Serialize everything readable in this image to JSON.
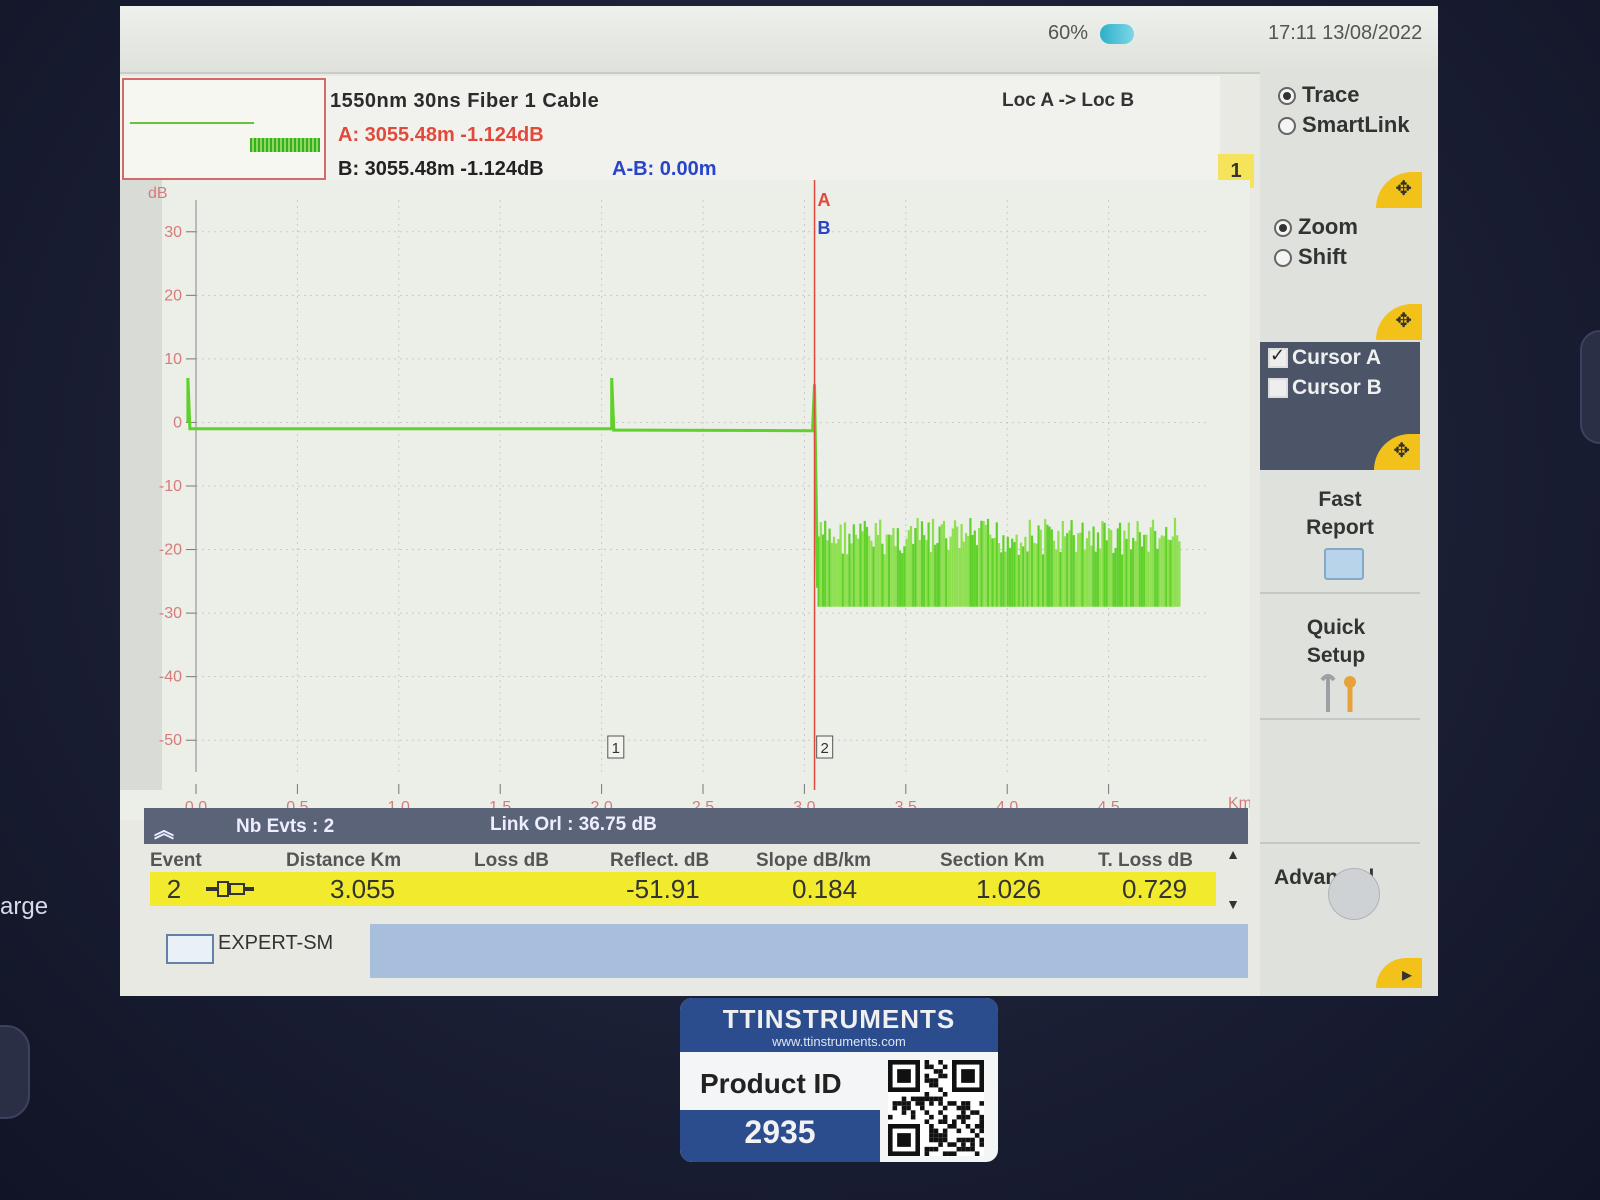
{
  "bezel": {
    "side_label": "arge"
  },
  "status": {
    "battery": "60%",
    "datetime": "17:11  13/08/2022"
  },
  "trace_info": {
    "line1": "1550nm  30ns  Fiber  1  Cable",
    "cursor_a": "A: 3055.48m -1.124dB",
    "cursor_b": "B: 3055.48m -1.124dB",
    "a_minus_b": "A-B: 0.00m",
    "direction": "Loc A -> Loc B",
    "trace_number": "1"
  },
  "right_panel": {
    "trace": "Trace",
    "smartlink": "SmartLink",
    "zoom": "Zoom",
    "shift": "Shift",
    "cursor_a": "Cursor A",
    "cursor_b": "Cursor B",
    "fast_report": [
      "Fast",
      "Report"
    ],
    "quick_setup": [
      "Quick",
      "Setup"
    ],
    "advanced": "Advanced",
    "accent_color": "#f2c21a"
  },
  "chart_data": {
    "type": "line",
    "ylabel": "dB",
    "xlabel": "Km",
    "xlim": [
      0.0,
      5.0
    ],
    "ylim": [
      -55,
      35
    ],
    "x_ticks": [
      "0.0",
      "0.5",
      "1.0",
      "1.5",
      "2.0",
      "2.5",
      "3.0",
      "3.5",
      "4.0",
      "4.5"
    ],
    "y_ticks": [
      "30",
      "20",
      "10",
      "0",
      "-10",
      "-20",
      "-30",
      "-40",
      "-50"
    ],
    "y_tick_values": [
      30,
      20,
      10,
      0,
      -10,
      -20,
      -30,
      -40,
      -50
    ],
    "trace": {
      "color": "#5fd12a",
      "points": [
        [
          -0.04,
          0
        ],
        [
          -0.04,
          7
        ],
        [
          -0.03,
          -1
        ],
        [
          2.05,
          -1
        ],
        [
          2.05,
          7
        ],
        [
          2.06,
          -1.2
        ],
        [
          3.04,
          -1.3
        ],
        [
          3.05,
          6
        ]
      ],
      "noise_range": [
        3.07,
        4.85
      ],
      "noise_low": -29,
      "noise_high": -15
    },
    "cursors": [
      {
        "label": "A",
        "x": 3.05,
        "color": "#e14a3a"
      },
      {
        "label": "B",
        "x": 3.05,
        "color": "#2a44c8"
      }
    ],
    "event_markers": [
      {
        "label": "1",
        "x": 2.07
      },
      {
        "label": "2",
        "x": 3.1
      }
    ]
  },
  "events": {
    "nb_evts": "Nb Evts : 2",
    "link_orl": "Link Orl :  36.75 dB",
    "columns": [
      "Event",
      "Distance  Km",
      "Loss dB",
      "Reflect. dB",
      "Slope  dB/km",
      "Section Km",
      "T. Loss dB"
    ],
    "row": {
      "event": "2",
      "distance": "3.055",
      "loss": "",
      "reflect": "-51.91",
      "slope": "0.184",
      "section": "1.026",
      "tloss": "0.729"
    }
  },
  "footer": {
    "mode": "EXPERT-SM"
  },
  "product_label": {
    "brand": "TTINSTRUMENTS",
    "url": "www.ttinstruments.com",
    "product_id_label": "Product ID",
    "product_id": "2935"
  }
}
